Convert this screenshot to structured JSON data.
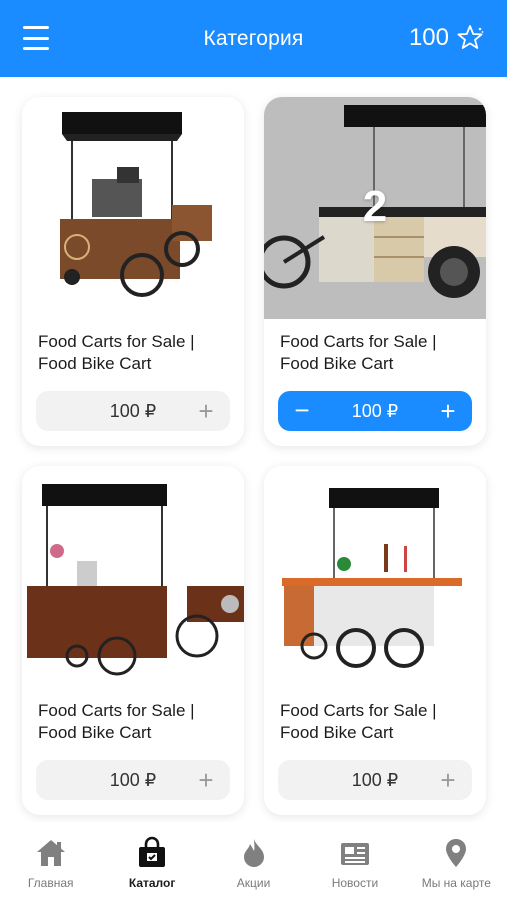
{
  "header": {
    "title": "Категория",
    "points": "100"
  },
  "products": [
    {
      "title": "Food Carts for Sale | Food Bike Cart",
      "price": "100 ₽",
      "in_cart": false
    },
    {
      "title": "Food Carts for Sale | Food Bike Cart",
      "price": "100 ₽",
      "in_cart": true,
      "quantity": "2"
    },
    {
      "title": "Food Carts for Sale | Food Bike Cart",
      "price": "100 ₽",
      "in_cart": false
    },
    {
      "title": "Food Carts for Sale | Food Bike Cart",
      "price": "100 ₽",
      "in_cart": false
    }
  ],
  "controls": {
    "plus": "+",
    "minus": "−"
  },
  "nav": {
    "items": [
      {
        "label": "Главная",
        "icon": "home-icon",
        "active": false
      },
      {
        "label": "Каталог",
        "icon": "shopping-bag-icon",
        "active": true
      },
      {
        "label": "Акции",
        "icon": "flame-icon",
        "active": false
      },
      {
        "label": "Новости",
        "icon": "newspaper-icon",
        "active": false
      },
      {
        "label": "Мы на карте",
        "icon": "map-pin-icon",
        "active": false
      }
    ]
  },
  "colors": {
    "accent": "#1a8cff",
    "card_bg": "#ffffff",
    "price_bg": "#f2f2f2"
  }
}
